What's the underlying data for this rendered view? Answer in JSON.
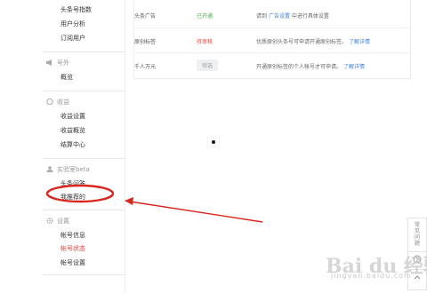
{
  "sidebar": {
    "top_items": [
      "头条号指数",
      "用户分析",
      "订阅用户"
    ],
    "sections": [
      {
        "title": "号外",
        "icon": "megaphone-icon",
        "items": [
          "概览"
        ]
      },
      {
        "title": "收益",
        "icon": "coin-icon",
        "items": [
          "收益设置",
          "收益概览",
          "结算中心"
        ]
      },
      {
        "title": "实验室beta",
        "icon": "user-icon",
        "items": [
          "头条问答",
          "我推荐的"
        ]
      },
      {
        "title": "设置",
        "icon": "gear-icon",
        "items": [
          "帐号信息",
          "帐号状态",
          "帐号设置"
        ]
      }
    ],
    "active_item": "帐号状态",
    "highlighted_item": "我推荐的"
  },
  "table": {
    "rows": [
      {
        "name": "头条广告",
        "status": "已开通",
        "desc_prefix": "请到",
        "desc_link": "广告设置",
        "desc_suffix": "中进行具体设置",
        "status_color": "#4caf50"
      },
      {
        "name": "原创标签",
        "status": "待审核",
        "desc_prefix": "优质原创头条号可申请开通原创标签。",
        "desc_link": "了解详情",
        "desc_suffix": "",
        "status_color": "#e0463d"
      },
      {
        "name": "千人万元",
        "status": "待选",
        "desc_prefix": "开通原创标签的个人帐号才可申请。",
        "desc_link": "了解详情",
        "desc_suffix": ""
      }
    ]
  },
  "float_bar": {
    "faq_label": "常见问题",
    "icons": [
      "help-circle-icon",
      "chevron-up-icon"
    ]
  },
  "watermark": {
    "logo_text": "Bai du 经验",
    "url": "jingyan.baidu.com"
  },
  "colors": {
    "accent_red": "#e0463d",
    "annotation_red": "#d9261c",
    "link_blue": "#3d7fd6"
  }
}
